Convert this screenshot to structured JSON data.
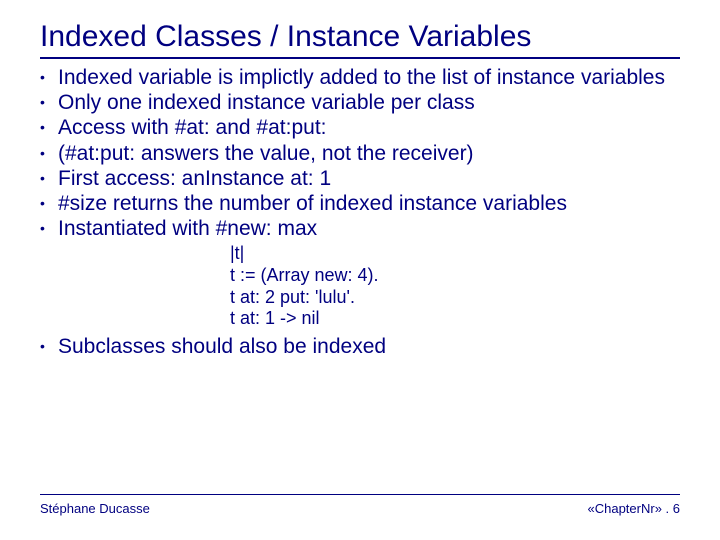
{
  "title": "Indexed Classes / Instance Variables",
  "bullets": [
    "Indexed variable is implictly added to the list of instance variables",
    "Only one indexed instance variable per class",
    "Access with #at: and #at:put:",
    "(#at:put: answers the value, not the receiver)",
    "First access: anInstance at: 1",
    "#size returns the number of indexed instance variables",
    "Instantiated with #new: max"
  ],
  "code": [
    "|t|",
    "t := (Array new: 4).",
    "t at: 2 put: 'lulu'.",
    "t at: 1 -> nil"
  ],
  "bullets_after": [
    "Subclasses should also be indexed"
  ],
  "footer": {
    "author": "Stéphane Ducasse",
    "pageref": "«ChapterNr» . 6"
  }
}
